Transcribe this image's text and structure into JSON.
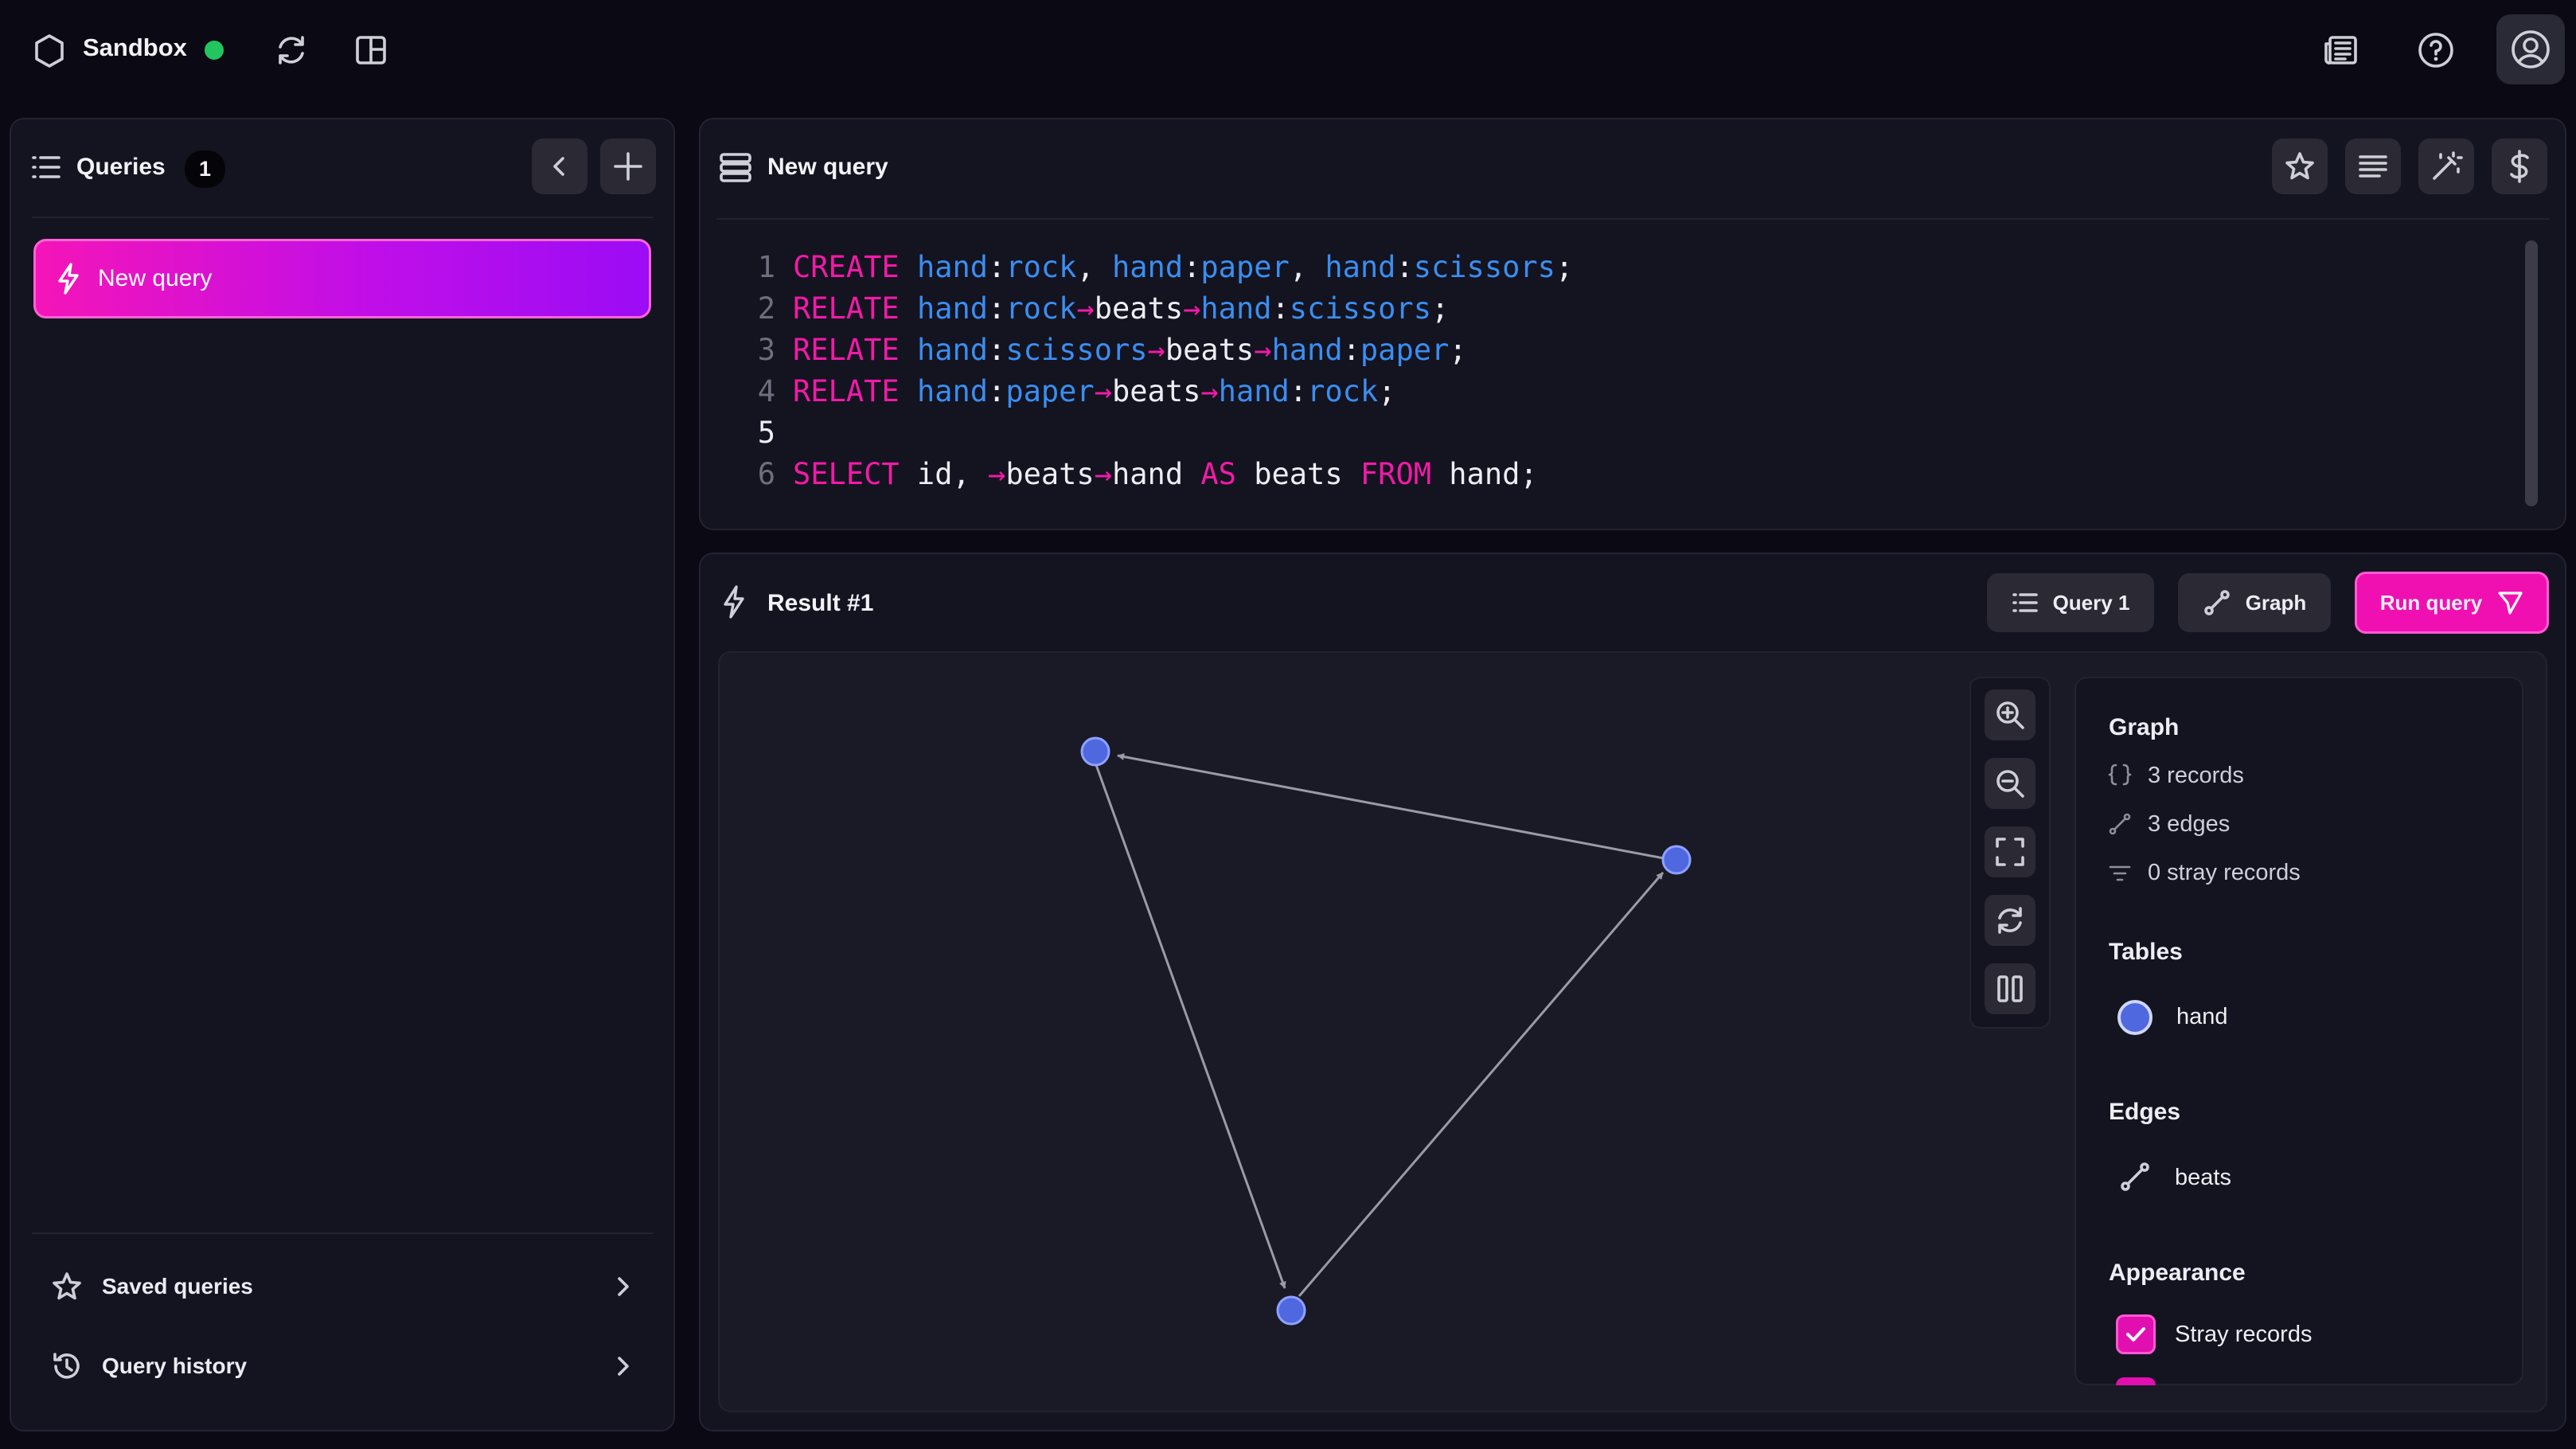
{
  "topbar": {
    "brand": "Sandbox",
    "status_color": "#22c55e",
    "icons": [
      "hexagon-icon",
      "refresh-icon",
      "layout-icon",
      "newspaper-icon",
      "help-icon",
      "user-icon"
    ]
  },
  "sidebar": {
    "title": "Queries",
    "count": "1",
    "items": [
      {
        "label": "New query",
        "active": true
      }
    ],
    "footer": [
      {
        "label": "Saved queries"
      },
      {
        "label": "Query history"
      }
    ]
  },
  "editor": {
    "title": "New query",
    "lines": [
      {
        "n": "1",
        "tokens": [
          [
            "kw",
            "CREATE"
          ],
          [
            "pl",
            " "
          ],
          [
            "tb",
            "hand"
          ],
          [
            "pl",
            ":"
          ],
          [
            "tb",
            "rock"
          ],
          [
            "pl",
            ", "
          ],
          [
            "tb",
            "hand"
          ],
          [
            "pl",
            ":"
          ],
          [
            "tb",
            "paper"
          ],
          [
            "pl",
            ", "
          ],
          [
            "tb",
            "hand"
          ],
          [
            "pl",
            ":"
          ],
          [
            "tb",
            "scissors"
          ],
          [
            "pl",
            ";"
          ]
        ]
      },
      {
        "n": "2",
        "tokens": [
          [
            "kw",
            "RELATE"
          ],
          [
            "pl",
            " "
          ],
          [
            "tb",
            "hand"
          ],
          [
            "pl",
            ":"
          ],
          [
            "tb",
            "rock"
          ],
          [
            "pk",
            "→"
          ],
          [
            "pl",
            "beats"
          ],
          [
            "pk",
            "→"
          ],
          [
            "tb",
            "hand"
          ],
          [
            "pl",
            ":"
          ],
          [
            "tb",
            "scissors"
          ],
          [
            "pl",
            ";"
          ]
        ]
      },
      {
        "n": "3",
        "tokens": [
          [
            "kw",
            "RELATE"
          ],
          [
            "pl",
            " "
          ],
          [
            "tb",
            "hand"
          ],
          [
            "pl",
            ":"
          ],
          [
            "tb",
            "scissors"
          ],
          [
            "pk",
            "→"
          ],
          [
            "pl",
            "beats"
          ],
          [
            "pk",
            "→"
          ],
          [
            "tb",
            "hand"
          ],
          [
            "pl",
            ":"
          ],
          [
            "tb",
            "paper"
          ],
          [
            "pl",
            ";"
          ]
        ]
      },
      {
        "n": "4",
        "tokens": [
          [
            "kw",
            "RELATE"
          ],
          [
            "pl",
            " "
          ],
          [
            "tb",
            "hand"
          ],
          [
            "pl",
            ":"
          ],
          [
            "tb",
            "paper"
          ],
          [
            "pk",
            "→"
          ],
          [
            "pl",
            "beats"
          ],
          [
            "pk",
            "→"
          ],
          [
            "tb",
            "hand"
          ],
          [
            "pl",
            ":"
          ],
          [
            "tb",
            "rock"
          ],
          [
            "pl",
            ";"
          ]
        ]
      },
      {
        "n": "5",
        "tokens": []
      },
      {
        "n": "6",
        "tokens": [
          [
            "kw",
            "SELECT"
          ],
          [
            "pl",
            " id, "
          ],
          [
            "pk",
            "→"
          ],
          [
            "pl",
            "beats"
          ],
          [
            "pk",
            "→"
          ],
          [
            "pl",
            "hand "
          ],
          [
            "kw",
            "AS"
          ],
          [
            "pl",
            " beats "
          ],
          [
            "kw",
            "FROM"
          ],
          [
            "pl",
            " hand;"
          ]
        ]
      }
    ]
  },
  "result": {
    "title": "Result #1",
    "query_button": "Query 1",
    "mode_button": "Graph",
    "run_button": "Run query"
  },
  "graph": {
    "node_color": "#4f68e0",
    "edge_color": "#9a9aa8"
  },
  "info": {
    "graph_title": "Graph",
    "records": "3 records",
    "edges": "3 edges",
    "stray": "0 stray records",
    "tables_title": "Tables",
    "table_name": "hand",
    "edges_title": "Edges",
    "edge_name": "beats",
    "appearance_title": "Appearance",
    "stray_toggle": "Stray records"
  }
}
